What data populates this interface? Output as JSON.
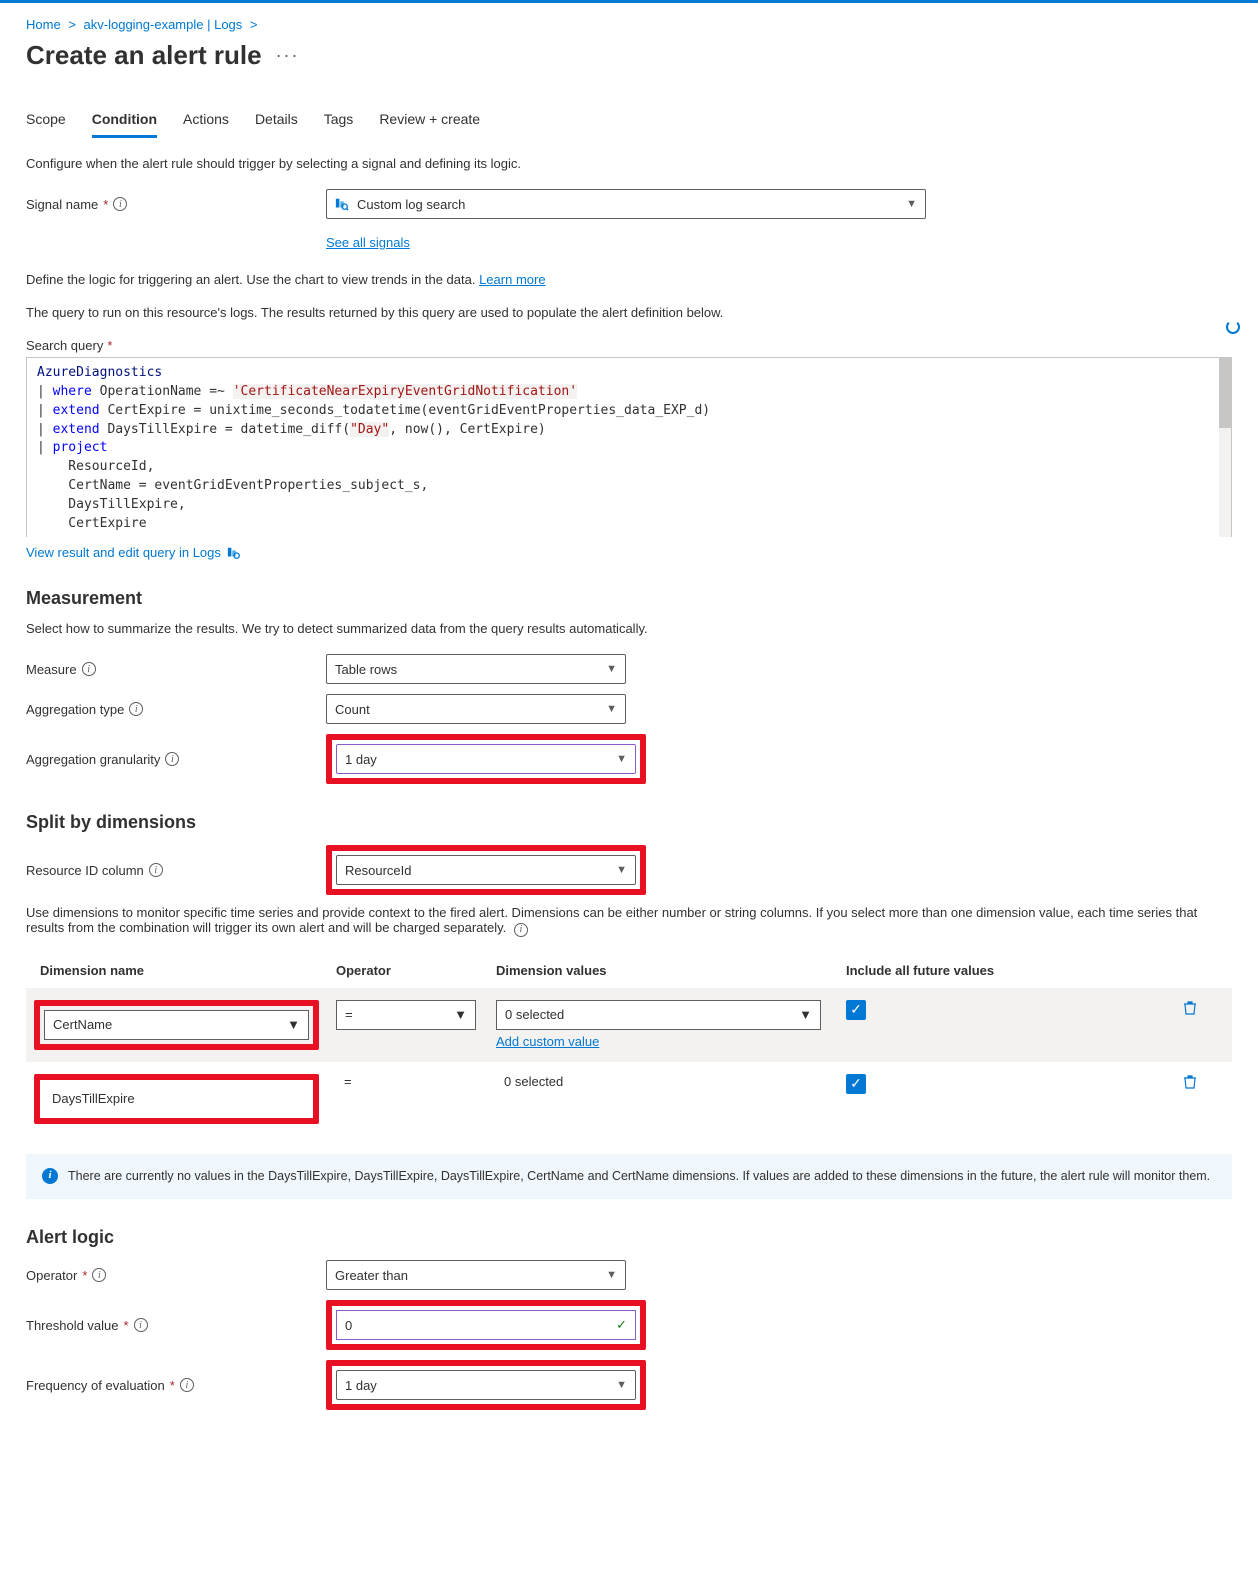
{
  "breadcrumb": {
    "home": "Home",
    "resource": "akv-logging-example | Logs"
  },
  "page_title": "Create an alert rule",
  "tabs": {
    "scope": "Scope",
    "condition": "Condition",
    "actions": "Actions",
    "details": "Details",
    "tags": "Tags",
    "review": "Review + create"
  },
  "intro_text": "Configure when the alert rule should trigger by selecting a signal and defining its logic.",
  "signal": {
    "label": "Signal name",
    "value": "Custom log search",
    "see_all": "See all signals"
  },
  "define_logic": "Define the logic for triggering an alert. Use the chart to view trends in the data. ",
  "learn_more": "Learn more",
  "query_desc": "The query to run on this resource's logs. The results returned by this query are used to populate the alert definition below.",
  "search_query_label": "Search query",
  "query_lines": [
    {
      "t": "ident",
      "v": "AzureDiagnostics"
    },
    {
      "raw": "| ",
      "kw": "where",
      "rest": " OperationName =~ ",
      "str": "'CertificateNearExpiryEventGridNotification'"
    },
    {
      "raw": "| ",
      "kw": "extend",
      "rest": " CertExpire = unixtime_seconds_todatetime(eventGridEventProperties_data_EXP_d)"
    },
    {
      "raw": "| ",
      "kw": "extend",
      "rest": " DaysTillExpire = datetime_diff(",
      "str": "\"Day\"",
      "rest2": ", now(), CertExpire)"
    },
    {
      "raw": "| ",
      "kw": "project",
      "rest": ""
    },
    {
      "indent": "    ",
      "rest": "ResourceId,"
    },
    {
      "indent": "    ",
      "rest": "CertName = eventGridEventProperties_subject_s,"
    },
    {
      "indent": "    ",
      "rest": "DaysTillExpire,"
    },
    {
      "indent": "    ",
      "rest": "CertExpire"
    }
  ],
  "view_result": "View result and edit query in Logs",
  "measurement": {
    "title": "Measurement",
    "desc": "Select how to summarize the results. We try to detect summarized data from the query results automatically.",
    "measure_label": "Measure",
    "measure_value": "Table rows",
    "agg_type_label": "Aggregation type",
    "agg_type_value": "Count",
    "agg_gran_label": "Aggregation granularity",
    "agg_gran_value": "1 day"
  },
  "split": {
    "title": "Split by dimensions",
    "resource_col_label": "Resource ID column",
    "resource_col_value": "ResourceId",
    "desc": "Use dimensions to monitor specific time series and provide context to the fired alert. Dimensions can be either number or string columns. If you select more than one dimension value, each time series that results from the combination will trigger its own alert and will be charged separately.",
    "headers": {
      "name": "Dimension name",
      "op": "Operator",
      "val": "Dimension values",
      "inc": "Include all future values"
    },
    "rows": [
      {
        "name": "CertName",
        "op": "=",
        "val": "0 selected",
        "add": "Add custom value"
      },
      {
        "name": "DaysTillExpire",
        "op": "=",
        "val": "0 selected"
      }
    ],
    "banner": "There are currently no values in the DaysTillExpire, DaysTillExpire, DaysTillExpire, CertName and CertName dimensions. If values are added to these dimensions in the future, the alert rule will monitor them."
  },
  "alert_logic": {
    "title": "Alert logic",
    "operator_label": "Operator",
    "operator_value": "Greater than",
    "threshold_label": "Threshold value",
    "threshold_value": "0",
    "freq_label": "Frequency of evaluation",
    "freq_value": "1 day"
  }
}
